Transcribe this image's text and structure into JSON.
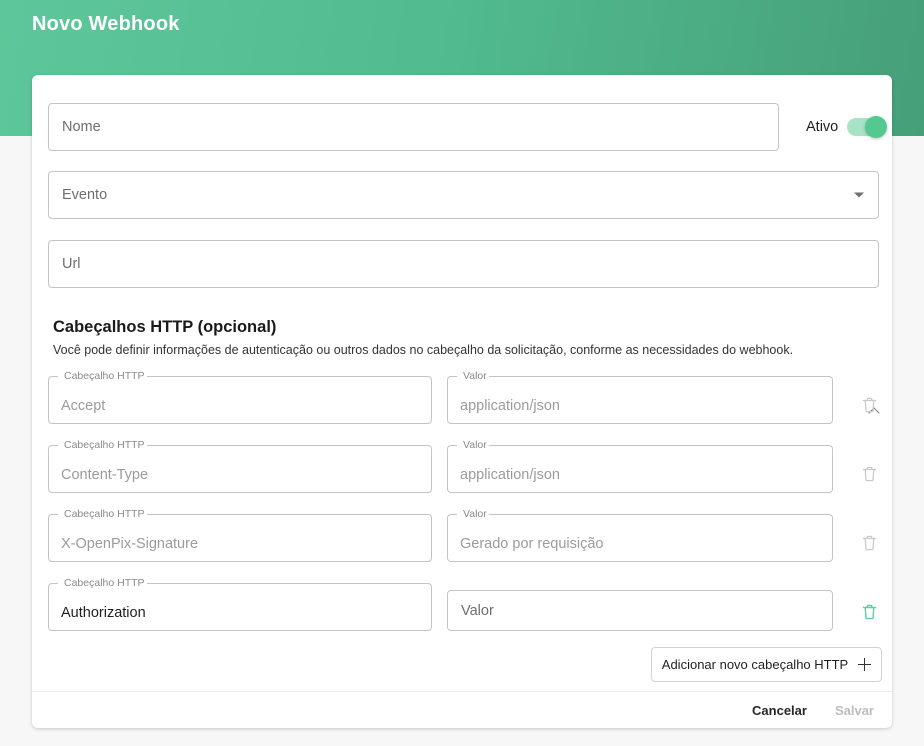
{
  "header": {
    "title": "Novo Webhook",
    "gradient_from": "#5ec79a",
    "gradient_to": "#469f79"
  },
  "form": {
    "nome": {
      "label": "Nome",
      "value": "",
      "placeholder": "Nome"
    },
    "evento": {
      "label": "Evento",
      "value": "",
      "placeholder": "Evento",
      "icon": "chevron-down-icon"
    },
    "url": {
      "label": "Url",
      "value": "",
      "placeholder": "Url"
    },
    "ativo": {
      "label": "Ativo",
      "checked": true,
      "on_color": "#53c991",
      "track_color": "#a8e3c7"
    }
  },
  "headers_section": {
    "title": "Cabeçalhos HTTP (opcional)",
    "description": "Você pode definir informações de autenticação ou outros dados no cabeçalho da solicitação, conforme as necessidades do webhook.",
    "collapse_icon": "chevron-up-icon",
    "key_label": "Cabeçalho HTTP",
    "value_label": "Valor",
    "rows": [
      {
        "key": "Accept",
        "key_label": "Cabeçalho HTTP",
        "value": "application/json",
        "value_label": "Valor",
        "key_filled": false,
        "value_filled": false,
        "value_has_label": true,
        "delete_enabled": false,
        "delete_color": "#c9c9c9"
      },
      {
        "key": "Content-Type",
        "key_label": "Cabeçalho HTTP",
        "value": "application/json",
        "value_label": "Valor",
        "key_filled": false,
        "value_filled": false,
        "value_has_label": true,
        "delete_enabled": false,
        "delete_color": "#c9c9c9"
      },
      {
        "key": "X-OpenPix-Signature",
        "key_label": "Cabeçalho HTTP",
        "value": "Gerado por requisição",
        "value_label": "Valor",
        "key_filled": false,
        "value_filled": false,
        "value_has_label": true,
        "delete_enabled": false,
        "delete_color": "#c9c9c9"
      },
      {
        "key": "Authorization",
        "key_label": "Cabeçalho HTTP",
        "value": "Valor",
        "value_label": "Valor",
        "key_filled": true,
        "value_filled": false,
        "value_has_label": false,
        "delete_enabled": true,
        "delete_color": "#5fcf9b"
      }
    ],
    "add_button": {
      "label": "Adicionar novo cabeçalho HTTP",
      "icon": "plus-icon"
    }
  },
  "footer": {
    "cancel_label": "Cancelar",
    "save_label": "Salvar",
    "save_enabled": false
  }
}
